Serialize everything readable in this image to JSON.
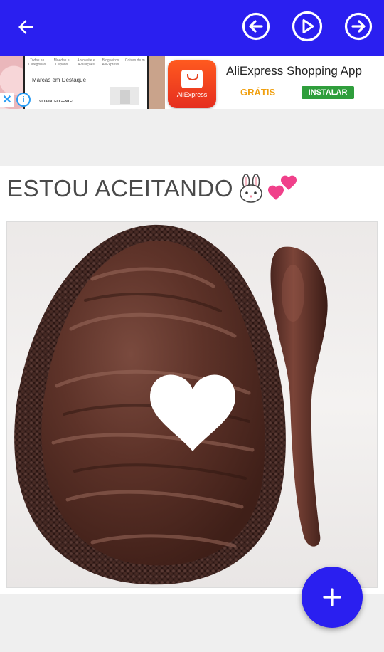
{
  "toolbar": {
    "back_icon": "arrow-left-icon",
    "prev_icon": "circle-arrow-left-icon",
    "play_icon": "circle-play-icon",
    "next_icon": "circle-arrow-right-icon",
    "bar_color": "#2a1ff0"
  },
  "ad": {
    "screenshot_categories": [
      "Todas as Categorias",
      "Moedas e Cupons",
      "Aproveite e Avaliações",
      "Blogueiros AliExpress",
      "Coisas de m"
    ],
    "screenshot_heading": "Marcas em Destaque",
    "screenshot_footer": "VIDA INTELIGENTE!",
    "app_icon_label": "AliExpress",
    "app_title": "AliExpress Shopping App",
    "price_label": "GRÁTIS",
    "install_label": "INSTALAR",
    "close_icon": "close-icon",
    "info_icon": "info-icon"
  },
  "post": {
    "caption": "ESTOU ACEITANDO",
    "caption_emojis": [
      "rabbit-face-emoji",
      "two-hearts-emoji"
    ],
    "image_description_icon": "chocolate-egg-with-spoon"
  },
  "fab": {
    "icon": "plus-icon",
    "color": "#2a1ff0"
  }
}
